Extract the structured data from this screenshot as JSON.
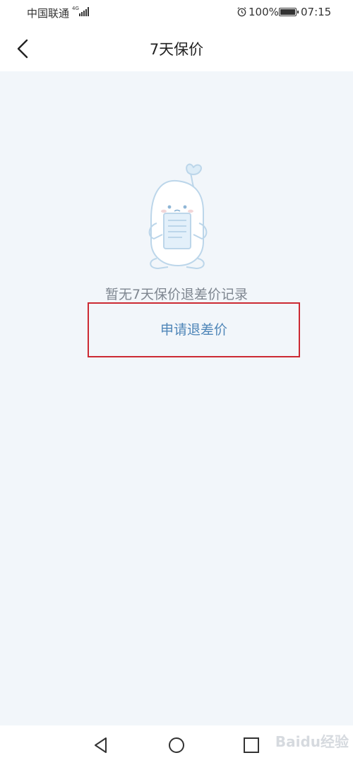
{
  "status_bar": {
    "carrier": "中国联通",
    "network_type": "4G",
    "battery": "100%",
    "time": "07:15"
  },
  "nav": {
    "title": "7天保价"
  },
  "main": {
    "empty_message": "暂无7天保价退差价记录",
    "apply_button_label": "申请退差价"
  },
  "colors": {
    "background": "#f2f6fa",
    "link": "#4f86b8",
    "highlight_border": "#cc2a33"
  },
  "icons": [
    "back-chevron-icon",
    "alarm-icon",
    "battery-icon",
    "signal-icon",
    "empty-record-mascot",
    "nav-back-icon",
    "nav-home-icon",
    "nav-recents-icon"
  ],
  "watermark": "Baidu经验"
}
